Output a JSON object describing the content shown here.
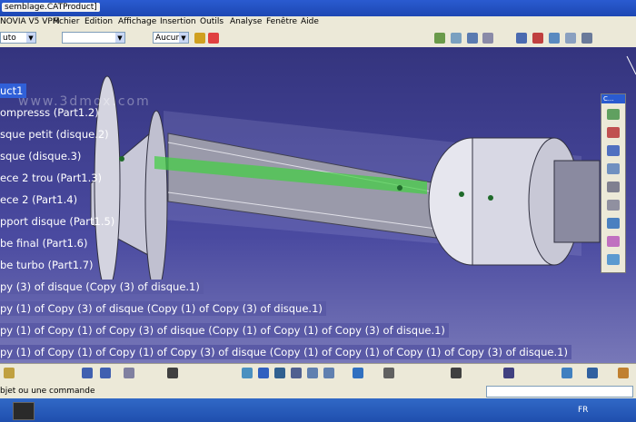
{
  "window": {
    "title": "semblage.CATProduct]",
    "brand": "NOVIA V5 VPM"
  },
  "menu": [
    "Fichier",
    "Edition",
    "Affichage",
    "Insertion",
    "Outils",
    "Analyse",
    "Fenêtre",
    "Aide"
  ],
  "toolbar": {
    "combo1": "uto",
    "combo2": "",
    "combo3": "Aucun"
  },
  "watermark": "www.3dmox.com",
  "tree": [
    "uct1",
    "ompresss (Part1.2)",
    "sque petit (disque.2)",
    "sque (disque.3)",
    "ece 2 trou (Part1.3)",
    "ece 2 (Part1.4)",
    "pport disque (Part1.5)",
    "be final (Part1.6)",
    "be turbo (Part1.7)",
    "py (3) of disque (Copy (3) of disque.1)",
    "py (1) of Copy (3) of disque (Copy (1) of Copy (3) of disque.1)",
    "py (1) of Copy (1) of Copy (3) of disque (Copy (1) of Copy (1) of Copy (3) of disque.1)",
    "py (1) of Copy (1) of Copy (1) of Copy (3) of disque (Copy (1) of Copy (1) of Copy (1) of Copy (3) of disque.1)"
  ],
  "palette_title": "C...",
  "status": {
    "text": "bjet ou une commande",
    "input": ""
  },
  "taskbar": {
    "lang": "FR"
  }
}
